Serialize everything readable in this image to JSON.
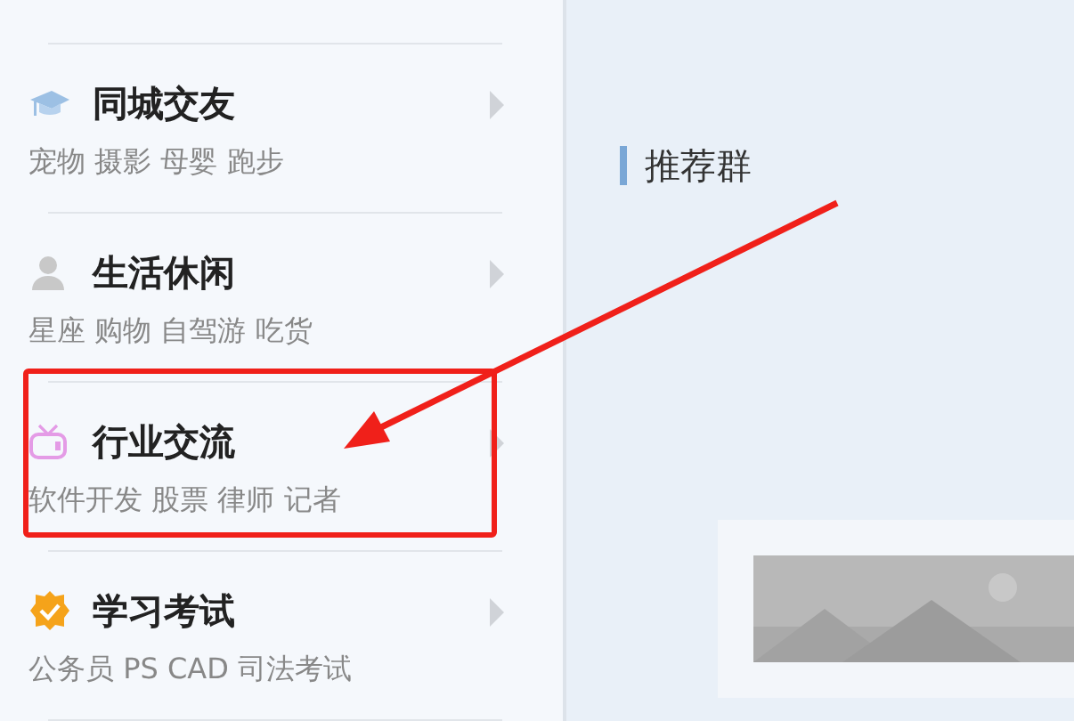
{
  "sidebar": {
    "items": [
      {
        "kind": "cap",
        "title": "同城交友",
        "tags": "宠物 摄影 母婴 跑步",
        "highlighted": false
      },
      {
        "kind": "person",
        "title": "生活休闲",
        "tags": "星座 购物 自驾游 吃货",
        "highlighted": false
      },
      {
        "kind": "tv",
        "title": "行业交流",
        "tags": "软件开发 股票 律师 记者",
        "highlighted": true
      },
      {
        "kind": "badge",
        "title": "学习考试",
        "tags": "公务员 PS CAD 司法考试",
        "highlighted": false
      }
    ]
  },
  "main": {
    "heading": "推荐群"
  }
}
